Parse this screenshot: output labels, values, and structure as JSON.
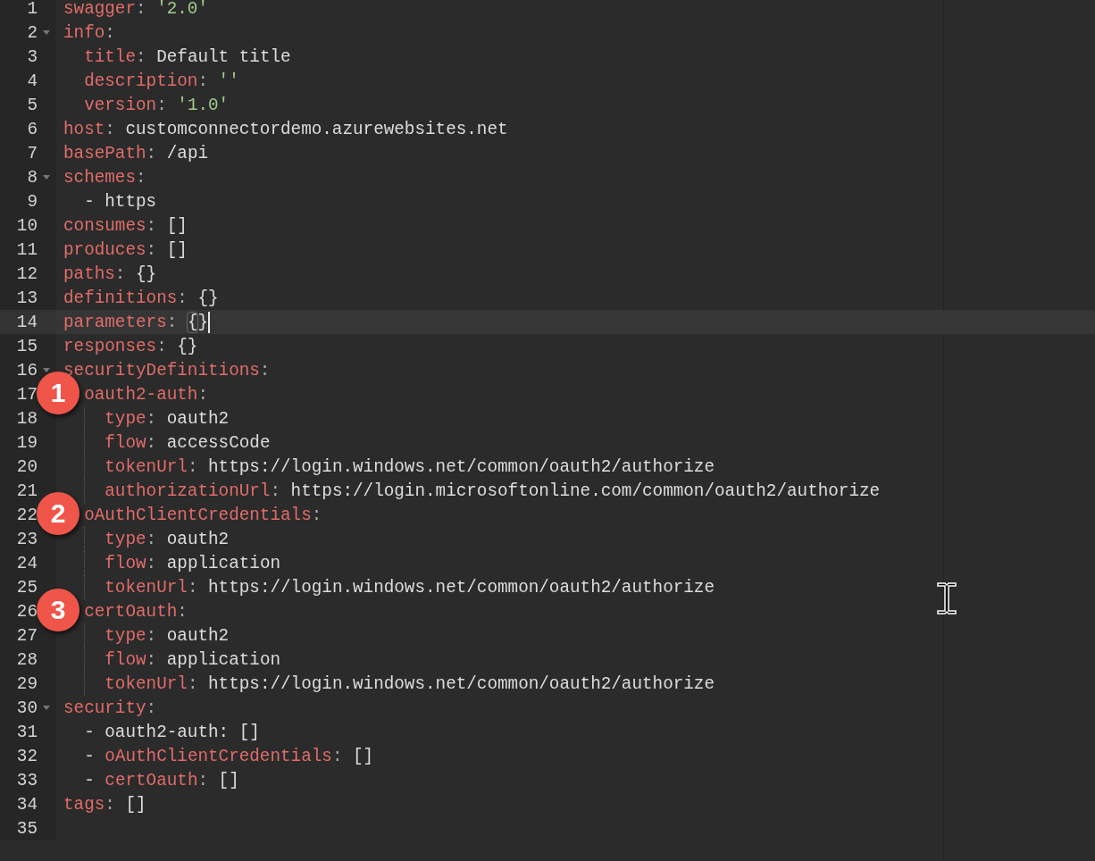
{
  "editor": {
    "lines": [
      {
        "number": "1",
        "foldable": false,
        "active": false,
        "guide": false,
        "cursor": false,
        "tokens": [
          {
            "kind": "key",
            "text": "swagger"
          },
          {
            "kind": "colon",
            "text": ": "
          },
          {
            "kind": "string",
            "text": "'2.0'"
          }
        ]
      },
      {
        "number": "2",
        "foldable": true,
        "active": false,
        "guide": false,
        "cursor": false,
        "tokens": [
          {
            "kind": "key",
            "text": "info"
          },
          {
            "kind": "colon",
            "text": ":"
          }
        ]
      },
      {
        "number": "3",
        "foldable": false,
        "active": false,
        "guide": false,
        "cursor": false,
        "tokens": [
          {
            "kind": "key",
            "text": "  title"
          },
          {
            "kind": "colon",
            "text": ": "
          },
          {
            "kind": "value",
            "text": "Default title"
          }
        ]
      },
      {
        "number": "4",
        "foldable": false,
        "active": false,
        "guide": false,
        "cursor": false,
        "tokens": [
          {
            "kind": "key",
            "text": "  description"
          },
          {
            "kind": "colon",
            "text": ": "
          },
          {
            "kind": "string",
            "text": "''"
          }
        ]
      },
      {
        "number": "5",
        "foldable": false,
        "active": false,
        "guide": false,
        "cursor": false,
        "tokens": [
          {
            "kind": "key",
            "text": "  version"
          },
          {
            "kind": "colon",
            "text": ": "
          },
          {
            "kind": "string",
            "text": "'1.0'"
          }
        ]
      },
      {
        "number": "6",
        "foldable": false,
        "active": false,
        "guide": false,
        "cursor": false,
        "tokens": [
          {
            "kind": "key",
            "text": "host"
          },
          {
            "kind": "colon",
            "text": ": "
          },
          {
            "kind": "value",
            "text": "customconnectordemo.azurewebsites.net"
          }
        ]
      },
      {
        "number": "7",
        "foldable": false,
        "active": false,
        "guide": false,
        "cursor": false,
        "tokens": [
          {
            "kind": "key",
            "text": "basePath"
          },
          {
            "kind": "colon",
            "text": ": "
          },
          {
            "kind": "value",
            "text": "/api"
          }
        ]
      },
      {
        "number": "8",
        "foldable": true,
        "active": false,
        "guide": false,
        "cursor": false,
        "tokens": [
          {
            "kind": "key",
            "text": "schemes"
          },
          {
            "kind": "colon",
            "text": ":"
          }
        ]
      },
      {
        "number": "9",
        "foldable": false,
        "active": false,
        "guide": false,
        "cursor": false,
        "tokens": [
          {
            "kind": "value",
            "text": "  - https"
          }
        ]
      },
      {
        "number": "10",
        "foldable": false,
        "active": false,
        "guide": false,
        "cursor": false,
        "tokens": [
          {
            "kind": "key",
            "text": "consumes"
          },
          {
            "kind": "colon",
            "text": ": "
          },
          {
            "kind": "value",
            "text": "[]"
          }
        ]
      },
      {
        "number": "11",
        "foldable": false,
        "active": false,
        "guide": false,
        "cursor": false,
        "tokens": [
          {
            "kind": "key",
            "text": "produces"
          },
          {
            "kind": "colon",
            "text": ": "
          },
          {
            "kind": "value",
            "text": "[]"
          }
        ]
      },
      {
        "number": "12",
        "foldable": false,
        "active": false,
        "guide": false,
        "cursor": false,
        "tokens": [
          {
            "kind": "key",
            "text": "paths"
          },
          {
            "kind": "colon",
            "text": ": "
          },
          {
            "kind": "value",
            "text": "{}"
          }
        ]
      },
      {
        "number": "13",
        "foldable": false,
        "active": false,
        "guide": false,
        "cursor": false,
        "tokens": [
          {
            "kind": "key",
            "text": "definitions"
          },
          {
            "kind": "colon",
            "text": ": "
          },
          {
            "kind": "value",
            "text": "{}"
          }
        ]
      },
      {
        "number": "14",
        "foldable": false,
        "active": true,
        "guide": false,
        "cursor": true,
        "tokens": [
          {
            "kind": "key",
            "text": "parameters"
          },
          {
            "kind": "colon",
            "text": ": "
          },
          {
            "kind": "matched-bracket",
            "text": "{"
          },
          {
            "kind": "value",
            "text": "}"
          }
        ]
      },
      {
        "number": "15",
        "foldable": false,
        "active": false,
        "guide": false,
        "cursor": false,
        "tokens": [
          {
            "kind": "key",
            "text": "responses"
          },
          {
            "kind": "colon",
            "text": ": "
          },
          {
            "kind": "value",
            "text": "{}"
          }
        ]
      },
      {
        "number": "16",
        "foldable": true,
        "active": false,
        "guide": false,
        "cursor": false,
        "tokens": [
          {
            "kind": "key",
            "text": "securityDefinitions"
          },
          {
            "kind": "colon",
            "text": ":"
          }
        ]
      },
      {
        "number": "17",
        "foldable": false,
        "active": false,
        "guide": false,
        "cursor": false,
        "badge": "1",
        "tokens": [
          {
            "kind": "key",
            "text": "  oauth2-auth"
          },
          {
            "kind": "colon",
            "text": ":"
          }
        ]
      },
      {
        "number": "18",
        "foldable": false,
        "active": false,
        "guide": true,
        "cursor": false,
        "tokens": [
          {
            "kind": "key",
            "text": "    type"
          },
          {
            "kind": "colon",
            "text": ": "
          },
          {
            "kind": "value",
            "text": "oauth2"
          }
        ]
      },
      {
        "number": "19",
        "foldable": false,
        "active": false,
        "guide": true,
        "cursor": false,
        "tokens": [
          {
            "kind": "key",
            "text": "    flow"
          },
          {
            "kind": "colon",
            "text": ": "
          },
          {
            "kind": "value",
            "text": "accessCode"
          }
        ]
      },
      {
        "number": "20",
        "foldable": false,
        "active": false,
        "guide": true,
        "cursor": false,
        "tokens": [
          {
            "kind": "key",
            "text": "    tokenUrl"
          },
          {
            "kind": "colon",
            "text": ": "
          },
          {
            "kind": "value",
            "text": "https://login.windows.net/common/oauth2/authorize"
          }
        ]
      },
      {
        "number": "21",
        "foldable": false,
        "active": false,
        "guide": true,
        "cursor": false,
        "tokens": [
          {
            "kind": "key",
            "text": "    authorizationUrl"
          },
          {
            "kind": "colon",
            "text": ": "
          },
          {
            "kind": "value",
            "text": "https://login.microsoftonline.com/common/oauth2/authorize"
          }
        ]
      },
      {
        "number": "22",
        "foldable": false,
        "active": false,
        "guide": false,
        "cursor": false,
        "badge": "2",
        "tokens": [
          {
            "kind": "key",
            "text": "  oAuthClientCredentials"
          },
          {
            "kind": "colon",
            "text": ":"
          }
        ]
      },
      {
        "number": "23",
        "foldable": false,
        "active": false,
        "guide": true,
        "cursor": false,
        "tokens": [
          {
            "kind": "key",
            "text": "    type"
          },
          {
            "kind": "colon",
            "text": ": "
          },
          {
            "kind": "value",
            "text": "oauth2"
          }
        ]
      },
      {
        "number": "24",
        "foldable": false,
        "active": false,
        "guide": true,
        "cursor": false,
        "tokens": [
          {
            "kind": "key",
            "text": "    flow"
          },
          {
            "kind": "colon",
            "text": ": "
          },
          {
            "kind": "value",
            "text": "application"
          }
        ]
      },
      {
        "number": "25",
        "foldable": false,
        "active": false,
        "guide": true,
        "cursor": false,
        "tokens": [
          {
            "kind": "key",
            "text": "    tokenUrl"
          },
          {
            "kind": "colon",
            "text": ": "
          },
          {
            "kind": "value",
            "text": "https://login.windows.net/common/oauth2/authorize"
          }
        ]
      },
      {
        "number": "26",
        "foldable": false,
        "active": false,
        "guide": false,
        "cursor": false,
        "badge": "3",
        "tokens": [
          {
            "kind": "key",
            "text": "  certOauth"
          },
          {
            "kind": "colon",
            "text": ":"
          }
        ]
      },
      {
        "number": "27",
        "foldable": false,
        "active": false,
        "guide": true,
        "cursor": false,
        "tokens": [
          {
            "kind": "key",
            "text": "    type"
          },
          {
            "kind": "colon",
            "text": ": "
          },
          {
            "kind": "value",
            "text": "oauth2"
          }
        ]
      },
      {
        "number": "28",
        "foldable": false,
        "active": false,
        "guide": true,
        "cursor": false,
        "tokens": [
          {
            "kind": "key",
            "text": "    flow"
          },
          {
            "kind": "colon",
            "text": ": "
          },
          {
            "kind": "value",
            "text": "application"
          }
        ]
      },
      {
        "number": "29",
        "foldable": false,
        "active": false,
        "guide": true,
        "cursor": false,
        "tokens": [
          {
            "kind": "key",
            "text": "    tokenUrl"
          },
          {
            "kind": "colon",
            "text": ": "
          },
          {
            "kind": "value",
            "text": "https://login.windows.net/common/oauth2/authorize"
          }
        ]
      },
      {
        "number": "30",
        "foldable": true,
        "active": false,
        "guide": false,
        "cursor": false,
        "tokens": [
          {
            "kind": "key",
            "text": "security"
          },
          {
            "kind": "colon",
            "text": ":"
          }
        ]
      },
      {
        "number": "31",
        "foldable": false,
        "active": false,
        "guide": false,
        "cursor": false,
        "tokens": [
          {
            "kind": "value",
            "text": "  - oauth2-auth: []"
          }
        ]
      },
      {
        "number": "32",
        "foldable": false,
        "active": false,
        "guide": false,
        "cursor": false,
        "tokens": [
          {
            "kind": "value",
            "text": "  - "
          },
          {
            "kind": "key",
            "text": "oAuthClientCredentials"
          },
          {
            "kind": "colon",
            "text": ": "
          },
          {
            "kind": "value",
            "text": "[]"
          }
        ]
      },
      {
        "number": "33",
        "foldable": false,
        "active": false,
        "guide": false,
        "cursor": false,
        "tokens": [
          {
            "kind": "value",
            "text": "  - "
          },
          {
            "kind": "key",
            "text": "certOauth"
          },
          {
            "kind": "colon",
            "text": ": "
          },
          {
            "kind": "value",
            "text": "[]"
          }
        ]
      },
      {
        "number": "34",
        "foldable": false,
        "active": false,
        "guide": false,
        "cursor": false,
        "tokens": [
          {
            "kind": "key",
            "text": "tags"
          },
          {
            "kind": "colon",
            "text": ": "
          },
          {
            "kind": "value",
            "text": "[]"
          }
        ]
      },
      {
        "number": "35",
        "foldable": false,
        "active": false,
        "guide": false,
        "cursor": false
      }
    ]
  }
}
